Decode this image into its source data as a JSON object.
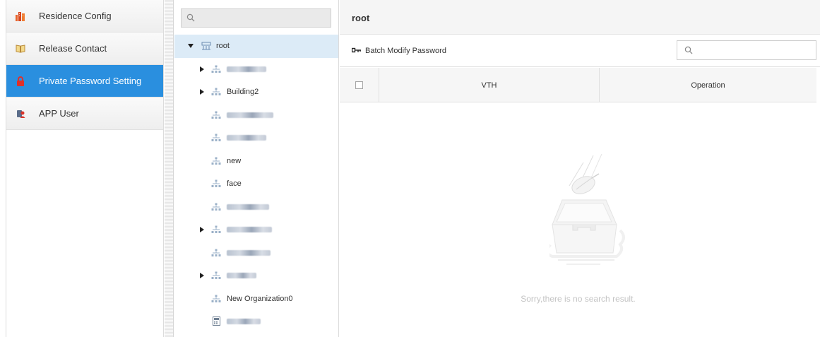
{
  "nav": {
    "items": [
      {
        "label": "Residence Config",
        "icon": "building-icon",
        "active": false
      },
      {
        "label": "Release Contact",
        "icon": "book-icon",
        "active": false
      },
      {
        "label": "Private Password Setting",
        "icon": "lock-icon",
        "active": true
      },
      {
        "label": "APP User",
        "icon": "user-phone-icon",
        "active": false
      }
    ]
  },
  "tree": {
    "search_placeholder": "",
    "nodes": [
      {
        "label": "root",
        "type": "root",
        "expanded": true,
        "selected": true
      },
      {
        "label": "",
        "type": "org",
        "blurred": true,
        "expandable": true
      },
      {
        "label": "Building2",
        "type": "org",
        "expandable": true
      },
      {
        "label": "",
        "type": "org",
        "blurred": true
      },
      {
        "label": "",
        "type": "org",
        "blurred": true
      },
      {
        "label": "new",
        "type": "org"
      },
      {
        "label": "face",
        "type": "org"
      },
      {
        "label": "",
        "type": "org",
        "blurred": true
      },
      {
        "label": "",
        "type": "org",
        "blurred": true,
        "expandable": true
      },
      {
        "label": "",
        "type": "org",
        "blurred": true
      },
      {
        "label": "",
        "type": "org",
        "blurred": true,
        "expandable": true
      },
      {
        "label": "New Organization0",
        "type": "org"
      },
      {
        "label": "",
        "type": "device",
        "blurred": true
      }
    ]
  },
  "main": {
    "title": "root",
    "toolbar": {
      "batch_label": "Batch Modify Password",
      "search_placeholder": ""
    },
    "table": {
      "columns": [
        "VTH",
        "Operation"
      ]
    },
    "empty_text": "Sorry,there is no search result."
  }
}
